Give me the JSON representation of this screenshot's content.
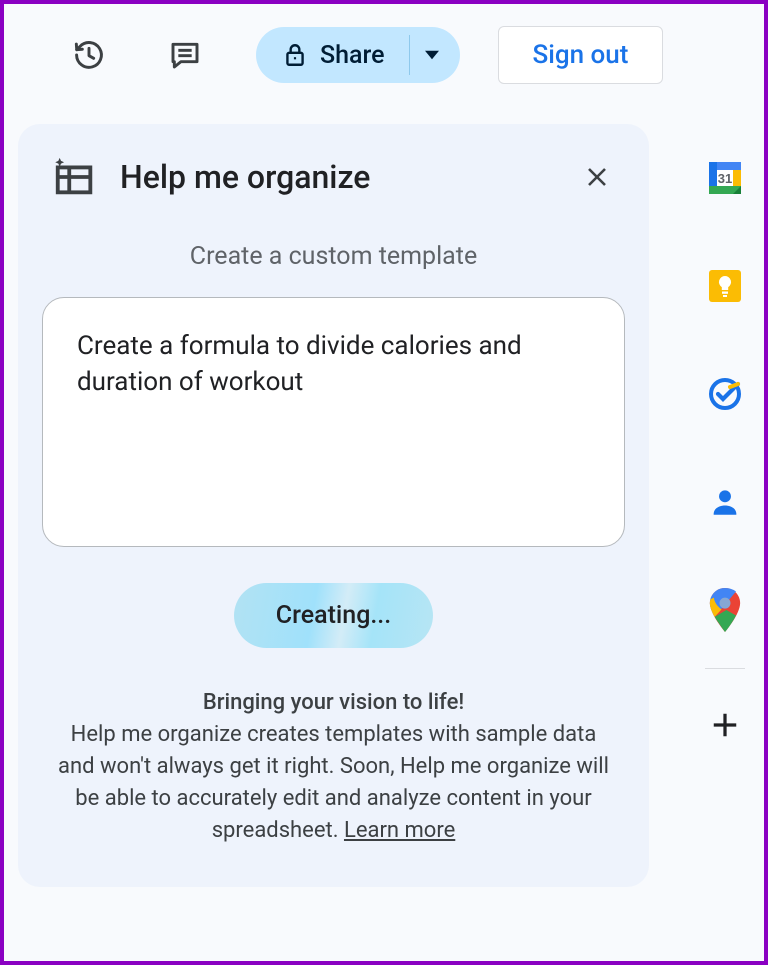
{
  "toolbar": {
    "share_label": "Share",
    "signout_label": "Sign out"
  },
  "panel": {
    "title": "Help me organize",
    "subtitle": "Create a custom template",
    "prompt_value": "Create a formula to divide calories and duration of workout",
    "creating_label": "Creating...",
    "tagline": "Bringing your vision to life!",
    "disclaimer_pre": "Help me organize creates templates with sample data and won't always get it right. Soon, Help me organize will be able to accurately edit and analyze content in your spreadsheet. ",
    "learn_more": "Learn more"
  },
  "side_icons": {
    "calendar": "31"
  }
}
